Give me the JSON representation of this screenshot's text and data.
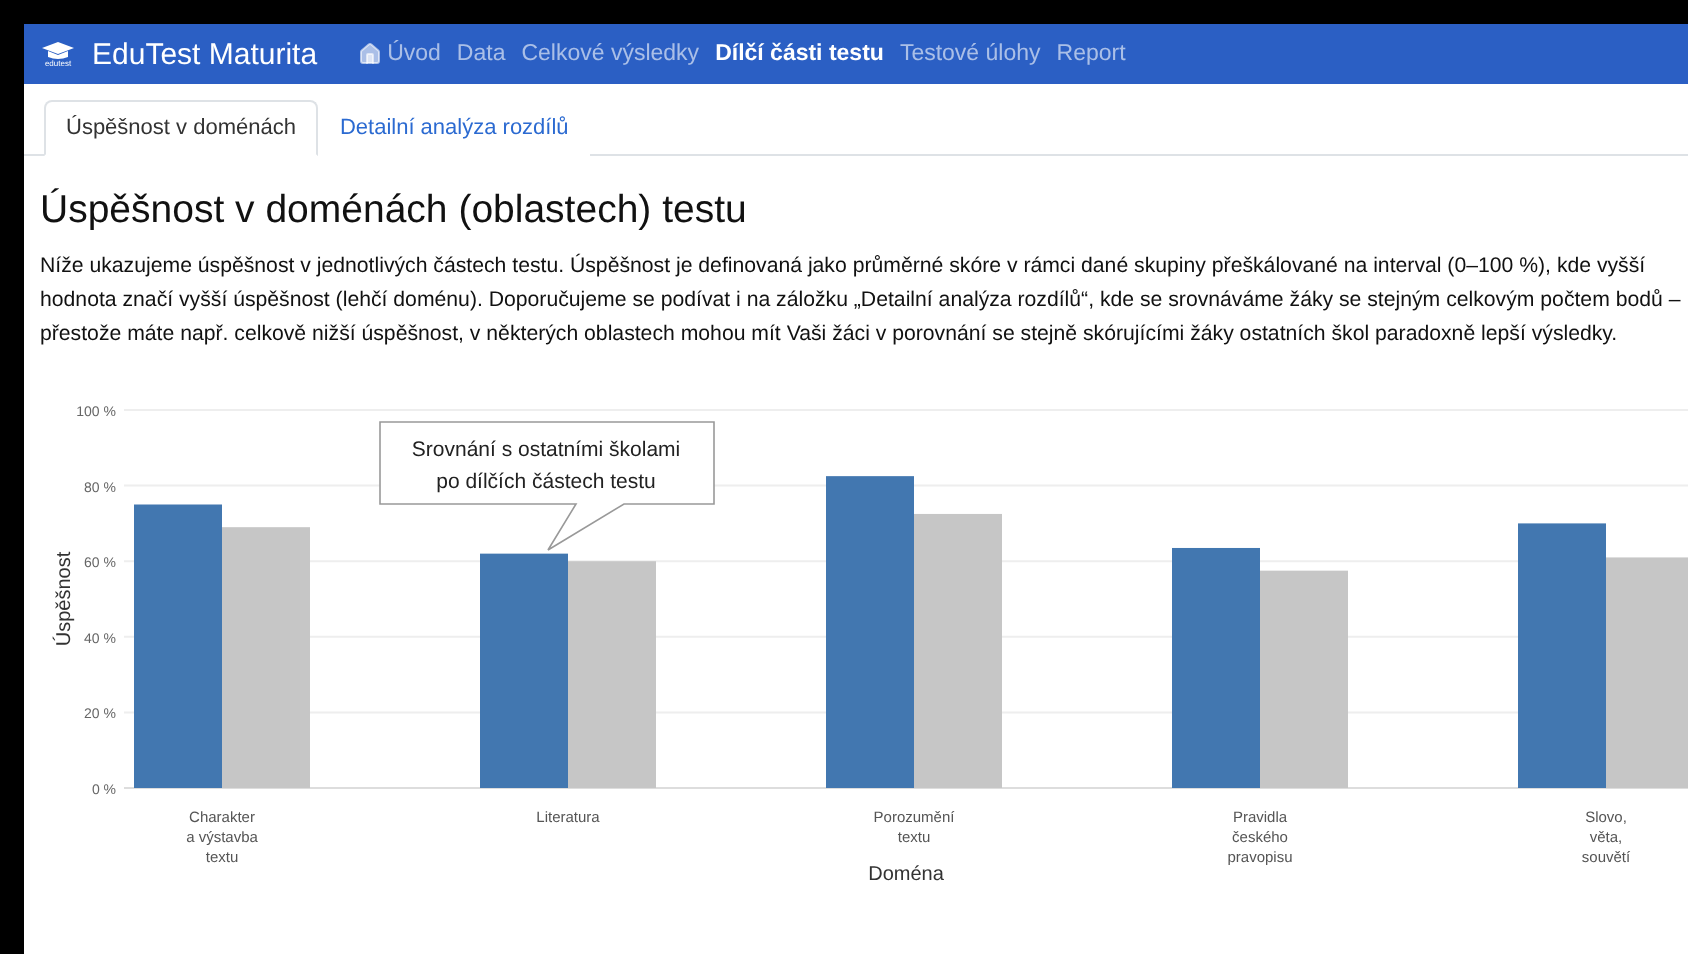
{
  "navbar": {
    "logo_caption": "edutest",
    "brand": "EduTest Maturita",
    "items": [
      {
        "label": "Úvod",
        "kind": "home",
        "selected": false
      },
      {
        "label": "Data",
        "kind": "link",
        "selected": false
      },
      {
        "label": "Celkové výsledky",
        "kind": "link",
        "selected": false
      },
      {
        "label": "Dílčí části testu",
        "kind": "link",
        "selected": true
      },
      {
        "label": "Testové úlohy",
        "kind": "link",
        "selected": false
      },
      {
        "label": "Report",
        "kind": "link",
        "selected": false
      }
    ]
  },
  "tabs": [
    {
      "label": "Úspěšnost v doménách",
      "selected": true
    },
    {
      "label": "Detailní analýza rozdílů",
      "selected": false
    }
  ],
  "heading": "Úspěšnost v doménách (oblastech) testu",
  "description": "Níže ukazujeme úspěšnost v jednotlivých částech testu. Úspěšnost je definovaná jako průměrné skóre v rámci dané skupiny přeškálované na interval (0–100 %), kde vyšší hodnota značí vyšší úspěšnost (lehčí doménu). Doporučujeme se podívat i na záložku „Detailní analýza rozdílů“, kde se srovnáváme žáky se stejným celkovým počtem bodů – přestože máte např. celkově nižší úspěšnost, v některých oblastech mohou mít Vaši žáci v porovnání se stejně skórujícími žáky ostatních škol paradoxně lepší výsledky.",
  "chart_data": {
    "type": "bar",
    "xlabel": "Doména",
    "ylabel": "Úspěšnost",
    "categories": [
      [
        "Charakter",
        "a výstavba",
        "textu"
      ],
      [
        "Literatura"
      ],
      [
        "Porozumění",
        "textu"
      ],
      [
        "Pravidla",
        "českého",
        "pravopisu"
      ],
      [
        "Slovo,",
        "věta,",
        "souvětí"
      ]
    ],
    "grid": true,
    "series": [
      {
        "color": "#4277b0",
        "values": [
          75,
          62,
          82.5,
          63.5,
          70
        ]
      },
      {
        "color": "#c6c6c6",
        "values": [
          69,
          60,
          72.5,
          57.5,
          61
        ]
      }
    ],
    "ylim": [
      0,
      100
    ],
    "yticks": [
      {
        "value": 0,
        "label": "0 %"
      },
      {
        "value": 20,
        "label": "20 %"
      },
      {
        "value": 40,
        "label": "40 %"
      },
      {
        "value": 60,
        "label": "60 %"
      },
      {
        "value": 80,
        "label": "80 %"
      },
      {
        "value": 100,
        "label": "100 %"
      }
    ],
    "annotations": [
      "Srovnání s ostatními školami\npo dílčích částech testu"
    ]
  }
}
